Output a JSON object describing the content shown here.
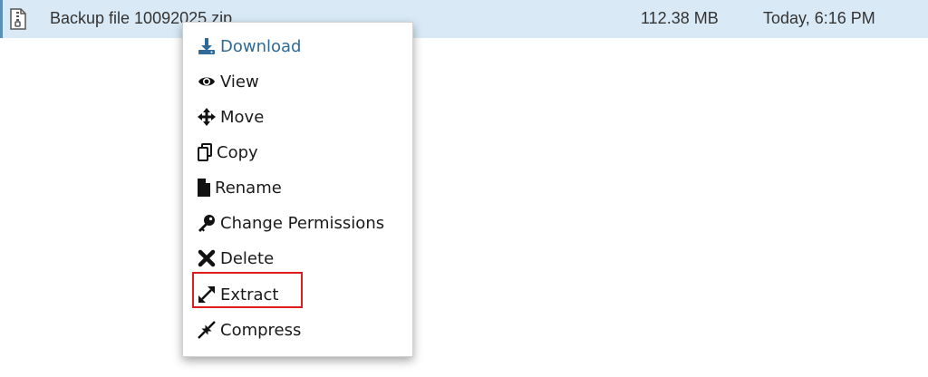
{
  "file": {
    "name": "Backup file 10092025.zip",
    "size": "112.38 MB",
    "modified": "Today, 6:16 PM",
    "icon": "zip-file-icon"
  },
  "context_menu": {
    "items": [
      {
        "label": "Download",
        "icon": "download-icon",
        "active": true
      },
      {
        "label": "View",
        "icon": "eye-icon"
      },
      {
        "label": "Move",
        "icon": "move-arrows-icon"
      },
      {
        "label": "Copy",
        "icon": "copy-icon"
      },
      {
        "label": "Rename",
        "icon": "file-icon"
      },
      {
        "label": "Change Permissions",
        "icon": "key-icon"
      },
      {
        "label": "Delete",
        "icon": "x-icon"
      },
      {
        "label": "Extract",
        "icon": "expand-icon",
        "highlighted": true
      },
      {
        "label": "Compress",
        "icon": "compress-icon"
      }
    ]
  },
  "colors": {
    "row_background": "#d9eaf6",
    "active_item": "#2f6a96",
    "highlight_border": "#e01b1b"
  }
}
